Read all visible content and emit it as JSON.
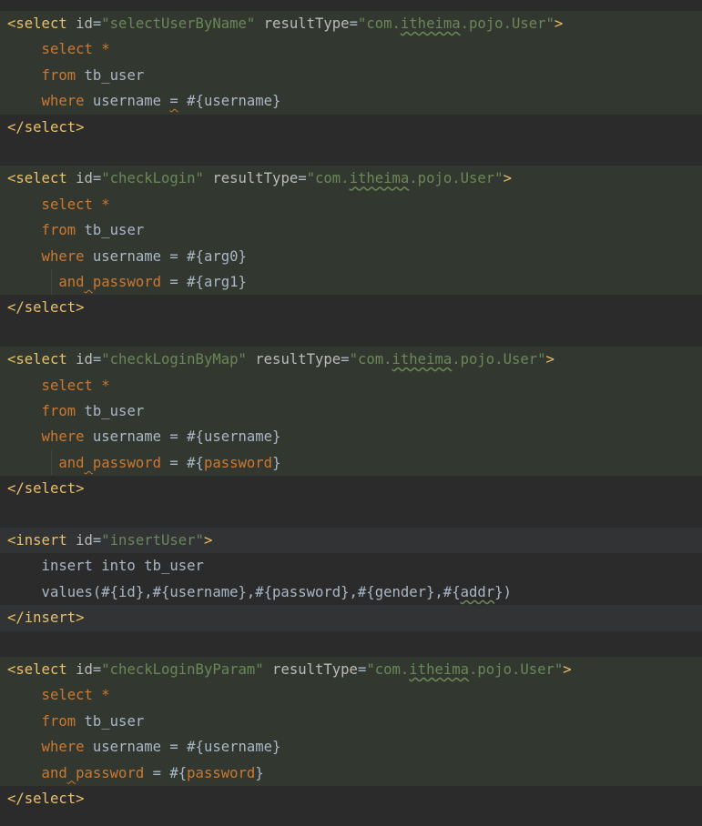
{
  "editor": {
    "language": "XML (MyBatis mapper)",
    "colors": {
      "background": "#2b2b2b",
      "tag": "#e8bf6a",
      "attribute": "#bababa",
      "string": "#6a8759",
      "keyword": "#cc7832",
      "text": "#a9b7c6",
      "block_highlight": "#32382f"
    },
    "lines": [
      {
        "hl": true,
        "tokens": [
          {
            "t": "<select",
            "c": "tag"
          },
          {
            "t": " id",
            "c": "attr"
          },
          {
            "t": "=",
            "c": "plain"
          },
          {
            "t": "\"selectUserByName\"",
            "c": "str"
          },
          {
            "t": " resultType",
            "c": "attr"
          },
          {
            "t": "=",
            "c": "plain"
          },
          {
            "t": "\"com.",
            "c": "str"
          },
          {
            "t": "itheima",
            "c": "str",
            "typo": true
          },
          {
            "t": ".pojo.User\"",
            "c": "str"
          },
          {
            "t": ">",
            "c": "tag"
          }
        ]
      },
      {
        "hl": true,
        "tokens": [
          {
            "t": "    select ",
            "c": "kw"
          },
          {
            "t": "*",
            "c": "kw"
          }
        ]
      },
      {
        "hl": true,
        "tokens": [
          {
            "t": "    from ",
            "c": "kw"
          },
          {
            "t": "tb_user",
            "c": "text"
          }
        ]
      },
      {
        "hl": true,
        "tokens": [
          {
            "t": "    where ",
            "c": "kw"
          },
          {
            "t": "username ",
            "c": "text"
          },
          {
            "t": "=",
            "c": "text",
            "typow": true
          },
          {
            "t": " #{username}",
            "c": "text"
          }
        ]
      },
      {
        "hl": false,
        "tokens": [
          {
            "t": "</select>",
            "c": "tag"
          }
        ]
      },
      {
        "hl": false,
        "tokens": []
      },
      {
        "hl": true,
        "tokens": [
          {
            "t": "<select",
            "c": "tag"
          },
          {
            "t": " id",
            "c": "attr"
          },
          {
            "t": "=",
            "c": "plain"
          },
          {
            "t": "\"checkLogin\"",
            "c": "str"
          },
          {
            "t": " resultType",
            "c": "attr"
          },
          {
            "t": "=",
            "c": "plain"
          },
          {
            "t": "\"com.",
            "c": "str"
          },
          {
            "t": "itheima",
            "c": "str",
            "typo": true
          },
          {
            "t": ".pojo.User\"",
            "c": "str"
          },
          {
            "t": ">",
            "c": "tag"
          }
        ]
      },
      {
        "hl": true,
        "tokens": [
          {
            "t": "    select ",
            "c": "kw"
          },
          {
            "t": "*",
            "c": "kw"
          }
        ]
      },
      {
        "hl": true,
        "tokens": [
          {
            "t": "    from ",
            "c": "kw"
          },
          {
            "t": "tb_user",
            "c": "text"
          }
        ]
      },
      {
        "hl": true,
        "tokens": [
          {
            "t": "    where ",
            "c": "kw"
          },
          {
            "t": "username = #{arg0}",
            "c": "text"
          }
        ]
      },
      {
        "hl": true,
        "guide": true,
        "tokens": [
          {
            "t": "      and",
            "c": "kw"
          },
          {
            "t": " ",
            "c": "kw",
            "typow": true
          },
          {
            "t": "password",
            "c": "kw"
          },
          {
            "t": " = #{arg1}",
            "c": "text"
          }
        ]
      },
      {
        "hl": false,
        "tokens": [
          {
            "t": "</select>",
            "c": "tag"
          }
        ]
      },
      {
        "hl": false,
        "tokens": []
      },
      {
        "hl": true,
        "tokens": [
          {
            "t": "<select",
            "c": "tag"
          },
          {
            "t": " id",
            "c": "attr"
          },
          {
            "t": "=",
            "c": "plain"
          },
          {
            "t": "\"checkLoginByMap\"",
            "c": "str"
          },
          {
            "t": " resultType",
            "c": "attr"
          },
          {
            "t": "=",
            "c": "plain"
          },
          {
            "t": "\"com.",
            "c": "str"
          },
          {
            "t": "itheima",
            "c": "str",
            "typo": true
          },
          {
            "t": ".pojo.User\"",
            "c": "str"
          },
          {
            "t": ">",
            "c": "tag"
          }
        ]
      },
      {
        "hl": true,
        "tokens": [
          {
            "t": "    select ",
            "c": "kw"
          },
          {
            "t": "*",
            "c": "kw"
          }
        ]
      },
      {
        "hl": true,
        "tokens": [
          {
            "t": "    from ",
            "c": "kw"
          },
          {
            "t": "tb_user",
            "c": "text"
          }
        ]
      },
      {
        "hl": true,
        "tokens": [
          {
            "t": "    where ",
            "c": "kw"
          },
          {
            "t": "username = #{username}",
            "c": "text"
          }
        ]
      },
      {
        "hl": true,
        "guide": true,
        "tokens": [
          {
            "t": "      and",
            "c": "kw"
          },
          {
            "t": " ",
            "c": "kw",
            "typow": true
          },
          {
            "t": "password",
            "c": "kw"
          },
          {
            "t": " = #{",
            "c": "text"
          },
          {
            "t": "password",
            "c": "kw"
          },
          {
            "t": "}",
            "c": "text"
          }
        ]
      },
      {
        "hl": false,
        "tokens": [
          {
            "t": "</select>",
            "c": "tag"
          }
        ]
      },
      {
        "hl": false,
        "tokens": []
      },
      {
        "hl": "ins",
        "tokens": [
          {
            "t": "<insert",
            "c": "tag"
          },
          {
            "t": " id",
            "c": "attr"
          },
          {
            "t": "=",
            "c": "plain"
          },
          {
            "t": "\"insertUser\"",
            "c": "str"
          },
          {
            "t": ">",
            "c": "tag"
          }
        ]
      },
      {
        "hl": false,
        "tokens": [
          {
            "t": "    insert into tb_user",
            "c": "text"
          }
        ]
      },
      {
        "hl": false,
        "tokens": [
          {
            "t": "    values(#{id},#{username},#{password},#{gender},#{",
            "c": "text"
          },
          {
            "t": "addr",
            "c": "text",
            "typo": true
          },
          {
            "t": "})",
            "c": "text"
          }
        ]
      },
      {
        "hl": "ins",
        "tokens": [
          {
            "t": "</insert>",
            "c": "tag"
          }
        ]
      },
      {
        "hl": false,
        "tokens": []
      },
      {
        "hl": true,
        "tokens": [
          {
            "t": "<select",
            "c": "tag"
          },
          {
            "t": " id",
            "c": "attr"
          },
          {
            "t": "=",
            "c": "plain"
          },
          {
            "t": "\"checkLoginByParam\"",
            "c": "str"
          },
          {
            "t": " resultType",
            "c": "attr"
          },
          {
            "t": "=",
            "c": "plain"
          },
          {
            "t": "\"com.",
            "c": "str"
          },
          {
            "t": "itheima",
            "c": "str",
            "typo": true
          },
          {
            "t": ".pojo.User\"",
            "c": "str"
          },
          {
            "t": ">",
            "c": "tag"
          }
        ]
      },
      {
        "hl": true,
        "tokens": [
          {
            "t": "    select ",
            "c": "kw"
          },
          {
            "t": "*",
            "c": "kw"
          }
        ]
      },
      {
        "hl": true,
        "tokens": [
          {
            "t": "    from ",
            "c": "kw"
          },
          {
            "t": "tb_user",
            "c": "text"
          }
        ]
      },
      {
        "hl": true,
        "tokens": [
          {
            "t": "    where ",
            "c": "kw"
          },
          {
            "t": "username = #{username}",
            "c": "text"
          }
        ]
      },
      {
        "hl": true,
        "tokens": [
          {
            "t": "    and",
            "c": "kw"
          },
          {
            "t": " ",
            "c": "kw",
            "typow": true
          },
          {
            "t": "password",
            "c": "kw"
          },
          {
            "t": " = #{",
            "c": "text"
          },
          {
            "t": "password",
            "c": "kw"
          },
          {
            "t": "}",
            "c": "text"
          }
        ]
      },
      {
        "hl": false,
        "tokens": [
          {
            "t": "</select>",
            "c": "tag"
          }
        ]
      }
    ]
  }
}
